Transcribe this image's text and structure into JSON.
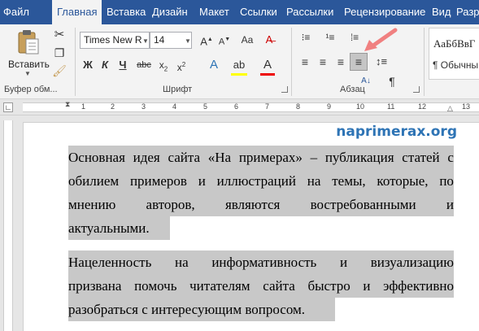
{
  "tabs": [
    "Файл",
    "Главная",
    "Вставка",
    "Дизайн",
    "Макет",
    "Ссылки",
    "Рассылки",
    "Рецензирование",
    "Вид",
    "Разр"
  ],
  "ribbon": {
    "clipboard": {
      "label": "Буфер обм...",
      "paste_label": "Вставить"
    },
    "font": {
      "label": "Шрифт",
      "font_name": "Times New R",
      "font_size": "14",
      "bold": "Ж",
      "italic": "К",
      "underline": "Ч"
    },
    "paragraph": {
      "label": "Абзац"
    },
    "styles": {
      "sample": "АаБбВвГ",
      "normal": "¶ Обычны"
    }
  },
  "ruler_numbers": [
    "1",
    "2",
    "3",
    "4",
    "5",
    "6",
    "7",
    "8",
    "9",
    "10",
    "11",
    "12",
    "13"
  ],
  "document": {
    "watermark": "naprimerax.org",
    "paragraph1": [
      "Основная идея сайта «На примерах» – публикация статей с",
      "обилием примеров и иллюстраций на темы, которые, по",
      "мнению авторов, являются востребованными и",
      "актуальными."
    ],
    "paragraph2": [
      "Нацеленность на информативность и визуализацию",
      "призвана помочь читателям сайта быстро и эффективно",
      "разобраться с интересующим вопросом."
    ]
  },
  "colors": {
    "ribbon_tabbar": "#2b579a",
    "selection": "#c8c8c8",
    "watermark": "#2e74b5",
    "arrow": "#f08080"
  }
}
